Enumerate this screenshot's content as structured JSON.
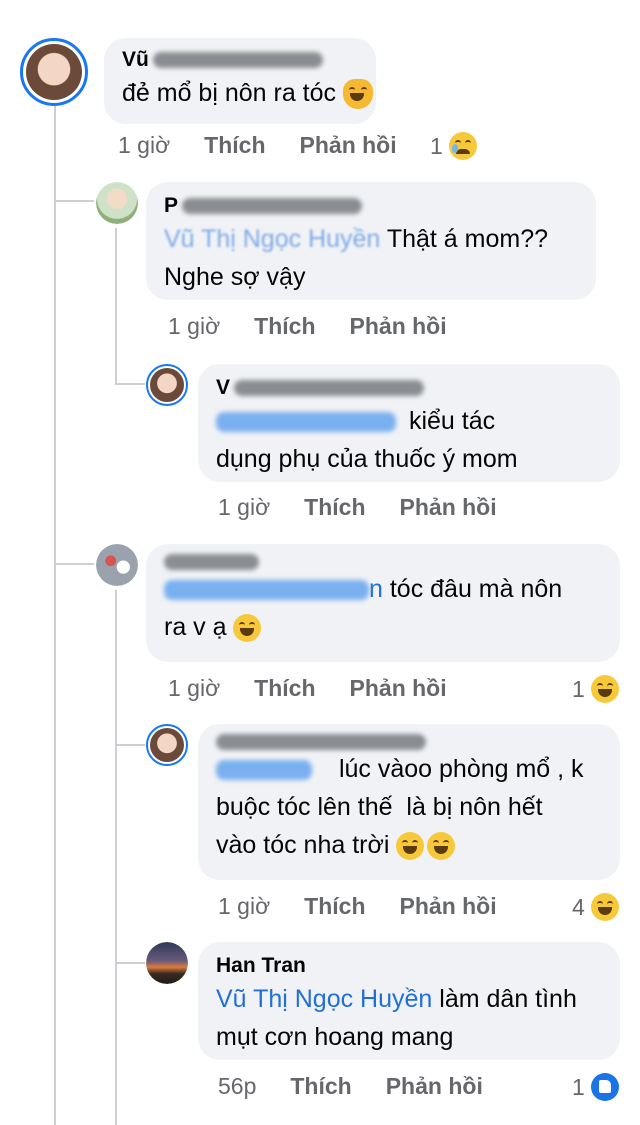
{
  "comments": [
    {
      "id": "c1",
      "author_visible": "Vũ",
      "text": "đẻ mổ bị nôn ra tóc",
      "emoji": "laughing-cat-icon",
      "time": "1 giờ",
      "like": "Thích",
      "reply": "Phản hồi",
      "reaction_count": "1",
      "reaction_icon": "sad-tear-icon"
    },
    {
      "id": "c2",
      "author_visible": "P",
      "mention": "Vũ Thị Ngọc Huyền",
      "text": "Thật á mom?? Nghe sợ vậy",
      "line1": "Thật á mom??",
      "line2": "Nghe sợ vậy",
      "time": "1 giờ",
      "like": "Thích",
      "reply": "Phản hồi"
    },
    {
      "id": "c3",
      "author_visible": "V",
      "mention_visible": "Phạm Thị Lan Anh",
      "line1": "kiểu tác",
      "line2": "dụng phụ của thuốc ý mom",
      "time": "1 giờ",
      "like": "Thích",
      "reply": "Phản hồi"
    },
    {
      "id": "c4",
      "author_visible": "Vân Anh",
      "mention_tail": "n",
      "line1": "tóc đâu mà nôn",
      "line2": "ra v ạ",
      "emoji": "grin-sweat-icon",
      "time": "1 giờ",
      "like": "Thích",
      "reply": "Phản hồi",
      "reaction_count": "1",
      "reaction_icon": "laughing-icon"
    },
    {
      "id": "c5",
      "author_visible": "Vũ Thị Ngọc Huyền",
      "mention_visible": "Vân Anh",
      "line1": "lúc vàoo phòng mổ , k",
      "line2": "buộc tóc lên thế  là bị nôn hết",
      "line3": "vào tóc nha trời",
      "time": "1 giờ",
      "like": "Thích",
      "reply": "Phản hồi",
      "reaction_count": "4",
      "reaction_icon": "laughing-icon"
    },
    {
      "id": "c6",
      "author": "Han Tran",
      "mention": "Vũ Thị Ngọc Huyền",
      "line1": "làm dân tình",
      "line2": "mụt cơn hoang mang",
      "time": "56p",
      "like": "Thích",
      "reply": "Phản hồi",
      "reaction_count": "1",
      "reaction_icon": "like-icon"
    }
  ],
  "colors": {
    "bubble": "#f0f2f5",
    "mention": "#216fdb",
    "meta": "#65676b",
    "ring": "#1877f2"
  }
}
